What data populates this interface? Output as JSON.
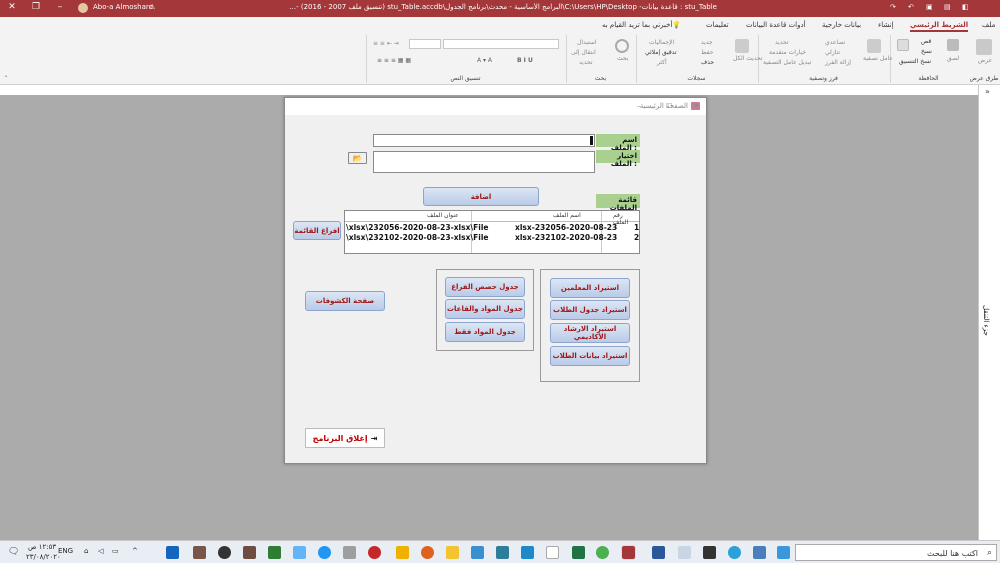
{
  "titlebar": {
    "app_title": "stu_Table : قاعدة بيانات- C:\\Users\\HP\\Desktop\\البرامج الأساسية - محدث\\برنامج الجدول\\stu_Table.accdb (تنسيق ملف 2007 - 2016) - Access",
    "user_name": "Abo-a Almosharo",
    "warning_icon": "warning-icon",
    "accent": "#a4373a"
  },
  "tabs": {
    "items": [
      {
        "label": "ملف"
      },
      {
        "label": "الشريط الرئيسي"
      },
      {
        "label": "إنشاء"
      },
      {
        "label": "بيانات خارجية"
      },
      {
        "label": "أدوات قاعدة البيانات"
      },
      {
        "label": "تعليمات"
      },
      {
        "label": "أخبرني بما تريد القيام به"
      }
    ]
  },
  "ribbon": {
    "groups": {
      "views": "طرق عرض",
      "clipboard": "الحافظة",
      "sort_filter": "فرز وتصفية",
      "records": "سجلات",
      "find": "بحث",
      "text_format": "تنسيق النص"
    },
    "views_btn": "عرض",
    "paste_btn": "لصق",
    "cut": "قص",
    "copy": "نسخ",
    "format_painter": "نسخ التنسيق",
    "filter_btn": "عامل تصفية",
    "ascending": "تصاعدي",
    "descending": "تنازلي",
    "remove_sort": "إزالة الفرز",
    "selection": "تحديد",
    "advanced": "خيارات متقدمة",
    "toggle_filter": "تبديل عامل التصفية",
    "refresh_all": "تحديث الكل",
    "new": "جديد",
    "save": "حفظ",
    "delete": "حذف",
    "totals": "الإجماليات",
    "spelling": "تدقيق إملائي",
    "more": "أكثر",
    "find_btn": "بحث",
    "replace": "استبدال",
    "goto": "انتقال إلى",
    "select": "تحديد"
  },
  "navpane": {
    "label": "جزء التنقل"
  },
  "form": {
    "title": "الصفحة الرئيسية",
    "file_name_label": "اسم الملف :",
    "choose_file_label": "اختيار الملف :",
    "add_button": "اضافة",
    "files_list_label": "قائمة الملفات",
    "empty_list_button": "افراغ القائمة",
    "reports_page_button": "صفحة الكشوفات",
    "close_program_button": "إغلاق البرنامج",
    "list": {
      "headers": [
        "رقم الملف",
        "اسم الملف",
        "عنوان الملف"
      ],
      "rows": [
        {
          "num": "1",
          "name": "232056-2020-08-23-xlsx",
          "path": "xlsx\\232056-2020-08-23-xlsx\\File\\"
        },
        {
          "num": "2",
          "name": "232102-2020-08-23-xlsx",
          "path": "xlsx\\232102-2020-08-23-xlsx\\File\\"
        }
      ]
    },
    "import_buttons": [
      "استيراد المعلمين",
      "استيراد جدول الطلاب",
      "استيراد الارشاد الأكاديمي",
      "استيراد بيانات الطلاب"
    ],
    "table_buttons": [
      "جدول حصص الفراغ",
      "جدول المواد والقاعات",
      "جدول المواد فقط"
    ],
    "label_color": "#a9d08e",
    "button_text_color": "#a01717"
  },
  "taskbar": {
    "search_placeholder": "اكتب هنا للبحث",
    "lang": "ENG",
    "time": "١٢:٥٣ ص",
    "date": "٢٣/٠٨/٢٠٢٠"
  }
}
